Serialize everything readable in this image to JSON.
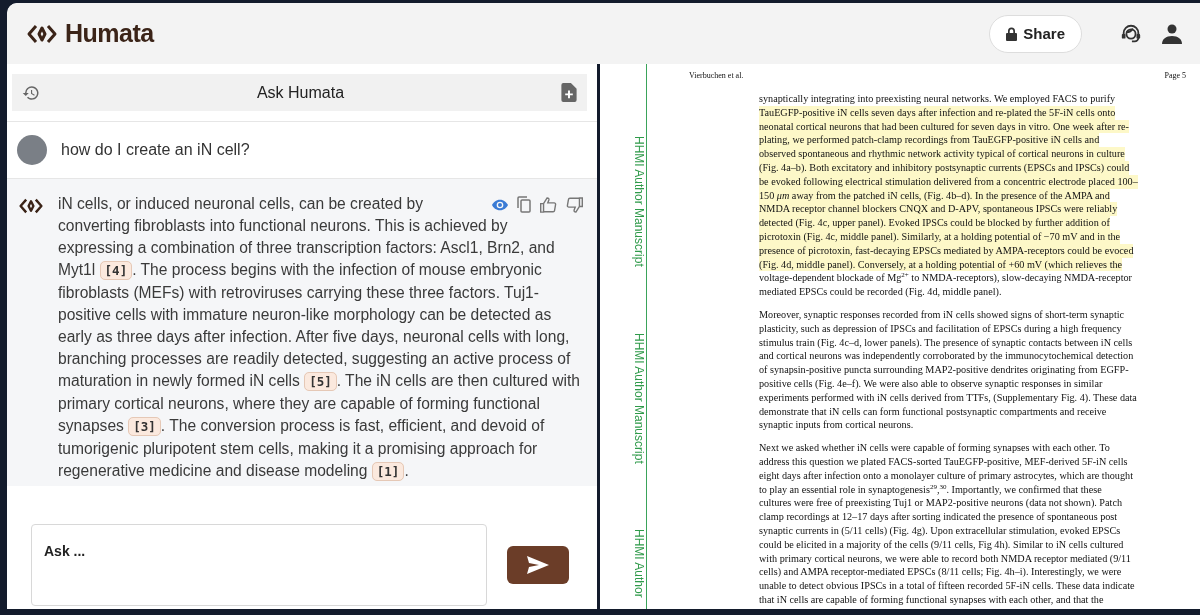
{
  "header": {
    "logo": "Humata",
    "share": "Share"
  },
  "chat": {
    "title": "Ask Humata",
    "messages": [
      {
        "kind": "question",
        "text": "how do I create an iN cell?"
      },
      {
        "kind": "answer",
        "segments": [
          {
            "kind": "text",
            "text": "iN cells, or induced neuronal cells, can be created by converting fibroblasts into functional neurons. This is achieved by expressing a combination of three transcription factors: Ascl1, Brn2, and Myt1l "
          },
          {
            "kind": "citation",
            "text": "[4]"
          },
          {
            "kind": "text",
            "text": ". The process begins with the infection of mouse embryonic fibroblasts (MEFs) with retroviruses carrying these three factors. Tuj1-positive cells with immature neuron-like morphology can be detected as early as three days after infection. After five days, neuronal cells with long, branching processes are readily detected, suggesting an active process of maturation in newly formed iN cells "
          },
          {
            "kind": "citation",
            "text": "[5]"
          },
          {
            "kind": "text",
            "text": ". The iN cells are then cultured with primary cortical neurons, where they are capable of forming functional synapses "
          },
          {
            "kind": "citation",
            "text": "[3]"
          },
          {
            "kind": "text",
            "text": ". The conversion process is fast, efficient, and devoid of tumorigenic pluripotent stem cells, making it a promising approach for regenerative medicine and disease modeling "
          },
          {
            "kind": "citation",
            "text": "[1]"
          },
          {
            "kind": "text",
            "text": "."
          }
        ]
      }
    ],
    "input": {
      "placeholder": "Ask ..."
    }
  },
  "document": {
    "running_head": "Vierbuchen et al.",
    "page": "Page 5",
    "side_labels": [
      "HHMI Author Manuscript",
      "HHMI Author Manuscript",
      "HHMI Author"
    ],
    "paragraphs": [
      {
        "lines": [
          {
            "text": "synaptically integrating into preexisting neural networks. We employed FACS to purify",
            "highlighted": false
          },
          {
            "text": "TauEGFP-positive iN cells seven days after infection and re-plated the 5F-iN cells onto",
            "highlighted": true
          },
          {
            "text": "neonatal cortical neurons that had been cultured for seven days in vitro. One week after re-",
            "highlighted": true
          },
          {
            "text": "plating, we performed patch-clamp recordings from TauEGFP-positive iN cells and",
            "highlighted": true
          },
          {
            "text": "observed spontaneous and rhythmic network activity typical of cortical neurons in culture",
            "highlighted": true
          },
          {
            "text": "(Fig. 4a–b). Both excitatory and inhibitory postsynaptic currents (EPSCs and IPSCs) could",
            "highlighted": true
          },
          {
            "text": "be evoked following electrical stimulation delivered from a concentric electrode placed 100–",
            "highlighted": true
          },
          {
            "text": "150 *μm* away from the patched iN cells, (Fig. 4b–d). In the presence of the AMPA and",
            "highlighted": true
          },
          {
            "text": "NMDA receptor channel blockers CNQX and D-APV, spontaneous IPSCs were reliably",
            "highlighted": true
          },
          {
            "text": "detected (Fig. 4c, upper panel). Evoked IPSCs could be blocked by further addition of",
            "highlighted": true
          },
          {
            "text": "picrotoxin (Fig. 4c, middle panel). Similarly, at a holding potential of −70 mV and in the",
            "highlighted": true
          },
          {
            "text": "presence of picrotoxin, fast-decaying EPSCs mediated by AMPA-receptors could be evoced",
            "highlighted": true
          },
          {
            "text": "(Fig. 4d, middle panel). Conversely, at a holding potential of +60 mV (which relieves the",
            "highlighted": true
          },
          {
            "text": "voltage-dependent blockade of Mg$^{2+}$ to NMDA-receptors), slow-decaying NMDA-receptor",
            "highlighted": false
          },
          {
            "text": "mediated EPSCs could be recorded (Fig. 4d, middle panel).",
            "highlighted": false
          }
        ]
      },
      {
        "lines": [
          {
            "text": "Moreover, synaptic responses recorded from iN cells showed signs of short-term synaptic",
            "highlighted": false
          },
          {
            "text": "plasticity, such as depression of IPSCs and facilitation of EPSCs during a high frequency",
            "highlighted": false
          },
          {
            "text": "stimulus train (Fig. 4c–d, lower panels). The presence of synaptic contacts between iN cells",
            "highlighted": false
          },
          {
            "text": "and cortical neurons was independently corroborated by the immunocytochemical detection",
            "highlighted": false
          },
          {
            "text": "of synapsin-positive puncta surrounding MAP2-positive dendrites originating from EGFP-",
            "highlighted": false
          },
          {
            "text": "positive cells (Fig. 4e–f). We were also able to observe synaptic responses in similar",
            "highlighted": false
          },
          {
            "text": "experiments performed with iN cells derived from TTFs, (Supplementary Fig. 4). These data",
            "highlighted": false
          },
          {
            "text": "demonstrate that iN cells can form functional postsynaptic compartments and receive",
            "highlighted": false
          },
          {
            "text": "synaptic inputs from cortical neurons.",
            "highlighted": false
          }
        ]
      },
      {
        "lines": [
          {
            "text": "Next we asked whether iN cells were capable of forming synapses with each other. To",
            "highlighted": false
          },
          {
            "text": "address this question we plated FACS-sorted TauEGFP-positive, MEF-derived 5F-iN cells",
            "highlighted": false
          },
          {
            "text": "eight days after infection onto a monolayer culture of primary astrocytes, which are thought",
            "highlighted": false
          },
          {
            "text": "to play an essential role in synaptogenesis$^{29}$,$^{30}$. Importantly, we confirmed that these",
            "highlighted": false
          },
          {
            "text": "cultures were free of preexisting Tuj1 or MAP2-positive neurons (data not shown). Patch",
            "highlighted": false
          },
          {
            "text": "clamp recordings at 12–17 days after sorting indicated the presence of spontaneous post",
            "highlighted": false
          },
          {
            "text": "synaptic currents in (5/11 cells) (Fig. 4g). Upon extracellular stimulation, evoked EPSCs",
            "highlighted": false
          },
          {
            "text": "could be elicited in a majority of the cells (9/11 cells, Fig 4h). Similar to iN cells cultured",
            "highlighted": false
          },
          {
            "text": "with primary cortical neurons, we were able to record both NMDA receptor mediated (9/11",
            "highlighted": false
          },
          {
            "text": "cells) and AMPA receptor-mediated EPSCs (8/11 cells; Fig. 4h–i). Interestingly, we were",
            "highlighted": false
          },
          {
            "text": "unable to detect obvious IPSCs in a total of fifteen recorded 5F-iN cells. These data indicate",
            "highlighted": false
          },
          {
            "text": "that iN cells are capable of forming functional synapses with each other, and that the",
            "highlighted": false
          }
        ]
      }
    ]
  }
}
